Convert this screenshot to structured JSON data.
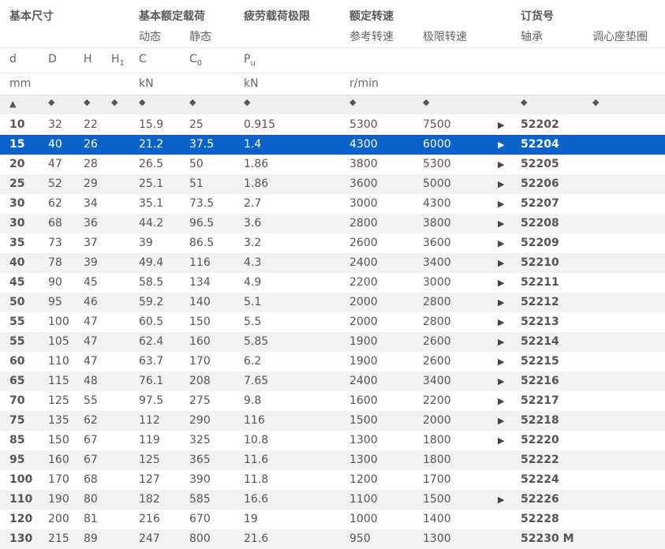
{
  "headers": {
    "group_basic_dims": "基本尺寸",
    "group_rated_load": "基本额定载荷",
    "group_fatigue": "疲劳载荷极限",
    "group_speed": "额定转速",
    "group_order": "订货号",
    "sub_dynamic": "动态",
    "sub_static": "静态",
    "sub_reference": "参考转速",
    "sub_limiting": "极限转速",
    "sub_bearing": "轴承",
    "sub_seat_washer": "调心座垫圈",
    "sym_d": "d",
    "sym_D": "D",
    "sym_H": "H",
    "sym_H1_base": "H",
    "sym_H1_sub": "1",
    "sym_C": "C",
    "sym_C0_base": "C",
    "sym_C0_sub": "0",
    "sym_Pu_base": "P",
    "sym_Pu_sub": "u",
    "unit_mm": "mm",
    "unit_kN_load": "kN",
    "unit_kN_fatigue": "kN",
    "unit_speed": "r/min",
    "sort_asc": "▲",
    "sort_both": "◆"
  },
  "selected_row_index": 1,
  "rows": [
    {
      "d": "10",
      "D": "32",
      "H": "22",
      "C": "15.9",
      "C0": "25",
      "Pu": "0.915",
      "ref": "5300",
      "lim": "7500",
      "arrow": "▶",
      "order": "52202"
    },
    {
      "d": "15",
      "D": "40",
      "H": "26",
      "C": "21.2",
      "C0": "37.5",
      "Pu": "1.4",
      "ref": "4300",
      "lim": "6000",
      "arrow": "▶",
      "order": "52204"
    },
    {
      "d": "20",
      "D": "47",
      "H": "28",
      "C": "26.5",
      "C0": "50",
      "Pu": "1.86",
      "ref": "3800",
      "lim": "5300",
      "arrow": "▶",
      "order": "52205"
    },
    {
      "d": "25",
      "D": "52",
      "H": "29",
      "C": "25.1",
      "C0": "51",
      "Pu": "1.86",
      "ref": "3600",
      "lim": "5000",
      "arrow": "▶",
      "order": "52206"
    },
    {
      "d": "30",
      "D": "62",
      "H": "34",
      "C": "35.1",
      "C0": "73.5",
      "Pu": "2.7",
      "ref": "3000",
      "lim": "4300",
      "arrow": "▶",
      "order": "52207"
    },
    {
      "d": "30",
      "D": "68",
      "H": "36",
      "C": "44.2",
      "C0": "96.5",
      "Pu": "3.6",
      "ref": "2800",
      "lim": "3800",
      "arrow": "▶",
      "order": "52208"
    },
    {
      "d": "35",
      "D": "73",
      "H": "37",
      "C": "39",
      "C0": "86.5",
      "Pu": "3.2",
      "ref": "2600",
      "lim": "3600",
      "arrow": "▶",
      "order": "52209"
    },
    {
      "d": "40",
      "D": "78",
      "H": "39",
      "C": "49.4",
      "C0": "116",
      "Pu": "4.3",
      "ref": "2400",
      "lim": "3400",
      "arrow": "▶",
      "order": "52210"
    },
    {
      "d": "45",
      "D": "90",
      "H": "45",
      "C": "58.5",
      "C0": "134",
      "Pu": "4.9",
      "ref": "2200",
      "lim": "3000",
      "arrow": "▶",
      "order": "52211"
    },
    {
      "d": "50",
      "D": "95",
      "H": "46",
      "C": "59.2",
      "C0": "140",
      "Pu": "5.1",
      "ref": "2000",
      "lim": "2800",
      "arrow": "▶",
      "order": "52212"
    },
    {
      "d": "55",
      "D": "100",
      "H": "47",
      "C": "60.5",
      "C0": "150",
      "Pu": "5.5",
      "ref": "2000",
      "lim": "2800",
      "arrow": "▶",
      "order": "52213"
    },
    {
      "d": "55",
      "D": "105",
      "H": "47",
      "C": "62.4",
      "C0": "160",
      "Pu": "5.85",
      "ref": "1900",
      "lim": "2600",
      "arrow": "▶",
      "order": "52214"
    },
    {
      "d": "60",
      "D": "110",
      "H": "47",
      "C": "63.7",
      "C0": "170",
      "Pu": "6.2",
      "ref": "1900",
      "lim": "2600",
      "arrow": "▶",
      "order": "52215"
    },
    {
      "d": "65",
      "D": "115",
      "H": "48",
      "C": "76.1",
      "C0": "208",
      "Pu": "7.65",
      "ref": "2400",
      "lim": "3400",
      "arrow": "▶",
      "order": "52216"
    },
    {
      "d": "70",
      "D": "125",
      "H": "55",
      "C": "97.5",
      "C0": "275",
      "Pu": "9.8",
      "ref": "1600",
      "lim": "2200",
      "arrow": "▶",
      "order": "52217"
    },
    {
      "d": "75",
      "D": "135",
      "H": "62",
      "C": "112",
      "C0": "290",
      "Pu": "116",
      "ref": "1500",
      "lim": "2000",
      "arrow": "▶",
      "order": "52218"
    },
    {
      "d": "85",
      "D": "150",
      "H": "67",
      "C": "119",
      "C0": "325",
      "Pu": "10.8",
      "ref": "1300",
      "lim": "1800",
      "arrow": "▶",
      "order": "52220"
    },
    {
      "d": "95",
      "D": "160",
      "H": "67",
      "C": "125",
      "C0": "365",
      "Pu": "11.6",
      "ref": "1300",
      "lim": "1800",
      "arrow": "",
      "order": "52222"
    },
    {
      "d": "100",
      "D": "170",
      "H": "68",
      "C": "127",
      "C0": "390",
      "Pu": "11.8",
      "ref": "1200",
      "lim": "1700",
      "arrow": "",
      "order": "52224"
    },
    {
      "d": "110",
      "D": "190",
      "H": "80",
      "C": "182",
      "C0": "585",
      "Pu": "16.6",
      "ref": "1100",
      "lim": "1500",
      "arrow": "▶",
      "order": "52226"
    },
    {
      "d": "120",
      "D": "200",
      "H": "81",
      "C": "216",
      "C0": "670",
      "Pu": "19",
      "ref": "1000",
      "lim": "1400",
      "arrow": "",
      "order": "52228"
    },
    {
      "d": "130",
      "D": "215",
      "H": "89",
      "C": "247",
      "C0": "800",
      "Pu": "21.6",
      "ref": "950",
      "lim": "1300",
      "arrow": "",
      "order": "52230 M"
    }
  ]
}
